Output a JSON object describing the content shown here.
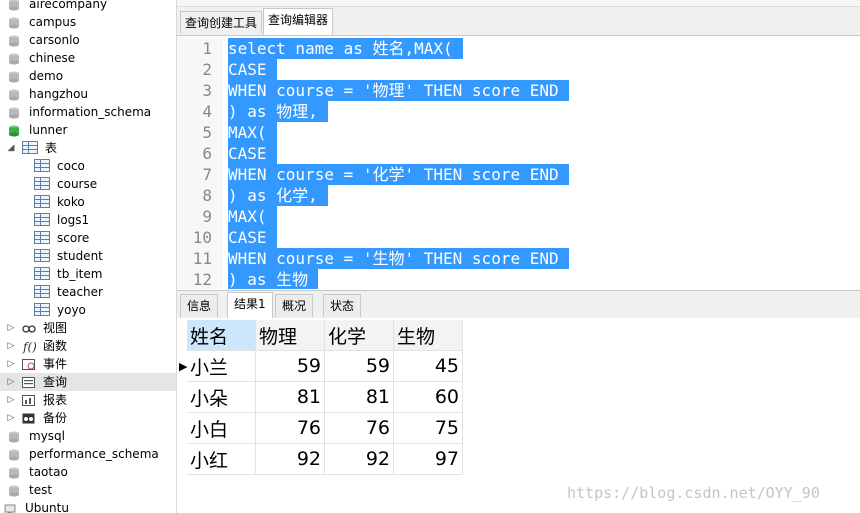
{
  "sidebar": {
    "items": [
      {
        "label": "airecompany",
        "type": "db"
      },
      {
        "label": "campus",
        "type": "db"
      },
      {
        "label": "carsonlo",
        "type": "db"
      },
      {
        "label": "chinese",
        "type": "db"
      },
      {
        "label": "demo",
        "type": "db"
      },
      {
        "label": "hangzhou",
        "type": "db"
      },
      {
        "label": "information_schema",
        "type": "db"
      },
      {
        "label": "lunner",
        "type": "db-open"
      },
      {
        "label": "表",
        "type": "folder-open"
      },
      {
        "label": "coco",
        "type": "table"
      },
      {
        "label": "course",
        "type": "table"
      },
      {
        "label": "koko",
        "type": "table"
      },
      {
        "label": "logs1",
        "type": "table"
      },
      {
        "label": "score",
        "type": "table"
      },
      {
        "label": "student",
        "type": "table"
      },
      {
        "label": "tb_item",
        "type": "table"
      },
      {
        "label": "teacher",
        "type": "table"
      },
      {
        "label": "yoyo",
        "type": "table"
      },
      {
        "label": "视图",
        "type": "views"
      },
      {
        "label": "函数",
        "type": "functions"
      },
      {
        "label": "事件",
        "type": "events"
      },
      {
        "label": "查询",
        "type": "queries",
        "selected": true
      },
      {
        "label": "报表",
        "type": "reports"
      },
      {
        "label": "备份",
        "type": "backups"
      },
      {
        "label": "mysql",
        "type": "db"
      },
      {
        "label": "performance_schema",
        "type": "db"
      },
      {
        "label": "taotao",
        "type": "db"
      },
      {
        "label": "test",
        "type": "db"
      },
      {
        "label": "Ubuntu",
        "type": "connection"
      }
    ]
  },
  "editor_tabs": [
    {
      "label": "查询创建工具",
      "active": false
    },
    {
      "label": "查询编辑器",
      "active": true
    }
  ],
  "editor": {
    "lines": [
      {
        "num": "1",
        "text": "select name as 姓名,MAX("
      },
      {
        "num": "2",
        "text": "CASE"
      },
      {
        "num": "3",
        "text": "WHEN course = '物理' THEN score END"
      },
      {
        "num": "4",
        "text": ") as 物理,"
      },
      {
        "num": "5",
        "text": "MAX("
      },
      {
        "num": "6",
        "text": "CASE"
      },
      {
        "num": "7",
        "text": "WHEN course = '化学' THEN score END"
      },
      {
        "num": "8",
        "text": ") as 化学,"
      },
      {
        "num": "9",
        "text": "MAX("
      },
      {
        "num": "10",
        "text": "CASE"
      },
      {
        "num": "11",
        "text": "WHEN course = '生物' THEN score END"
      },
      {
        "num": "12",
        "text": ") as 生物"
      }
    ]
  },
  "result_tabs": [
    {
      "label": "信息",
      "active": false
    },
    {
      "label": "结果1",
      "active": true
    },
    {
      "label": "概况",
      "active": false
    },
    {
      "label": "状态",
      "active": false
    }
  ],
  "grid": {
    "columns": [
      "姓名",
      "物理",
      "化学",
      "生物"
    ],
    "rows": [
      [
        "小兰",
        "59",
        "59",
        "45"
      ],
      [
        "小朵",
        "81",
        "81",
        "60"
      ],
      [
        "小白",
        "76",
        "76",
        "75"
      ],
      [
        "小红",
        "92",
        "92",
        "97"
      ]
    ]
  },
  "watermark": "https://blog.csdn.net/OYY_90",
  "colors": {
    "selection": "#3399ff",
    "db_icon": "#b9b9b9",
    "db_open_icon": "#3fae49",
    "header_selected": "#cde6fb"
  }
}
